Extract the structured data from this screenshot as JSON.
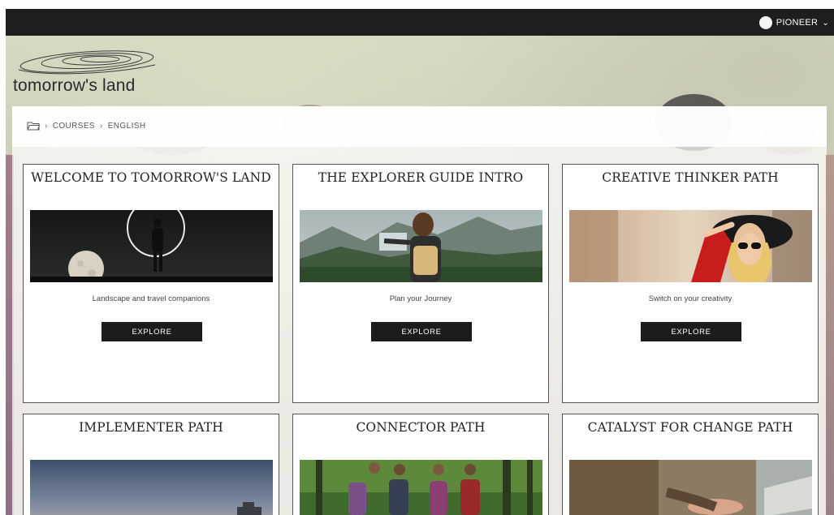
{
  "topbar": {
    "user_name": "PIONEER",
    "user_menu_icon": "chevron-down-icon"
  },
  "brand": {
    "logo_text": "tomorrow's land",
    "logo_icon": "swirl-logo-icon"
  },
  "breadcrumb": {
    "home_icon": "folder-icon",
    "separator": "›",
    "items": [
      "COURSES",
      "ENGLISH"
    ]
  },
  "cards": [
    {
      "title": "WELCOME TO TOMORROW'S LAND",
      "image_icon": "night-moon-image",
      "description": "Landscape and travel companions",
      "button": "EXPLORE"
    },
    {
      "title": "THE EXPLORER GUIDE INTRO",
      "image_icon": "hiker-map-image",
      "description": "Plan your Journey",
      "button": "EXPLORE"
    },
    {
      "title": "CREATIVE THINKER PATH",
      "image_icon": "woman-hat-image",
      "description": "Switch on your creativity",
      "button": "EXPLORE"
    },
    {
      "title": "IMPLEMENTER PATH",
      "image_icon": "dusk-landscape-image"
    },
    {
      "title": "CONNECTOR PATH",
      "image_icon": "forest-hikers-image"
    },
    {
      "title": "CATALYST FOR CHANGE PATH",
      "image_icon": "open-hand-image"
    }
  ],
  "colors": {
    "topbar": "#1e1e1e",
    "button": "#1c1c1c",
    "card_border": "#555555"
  }
}
